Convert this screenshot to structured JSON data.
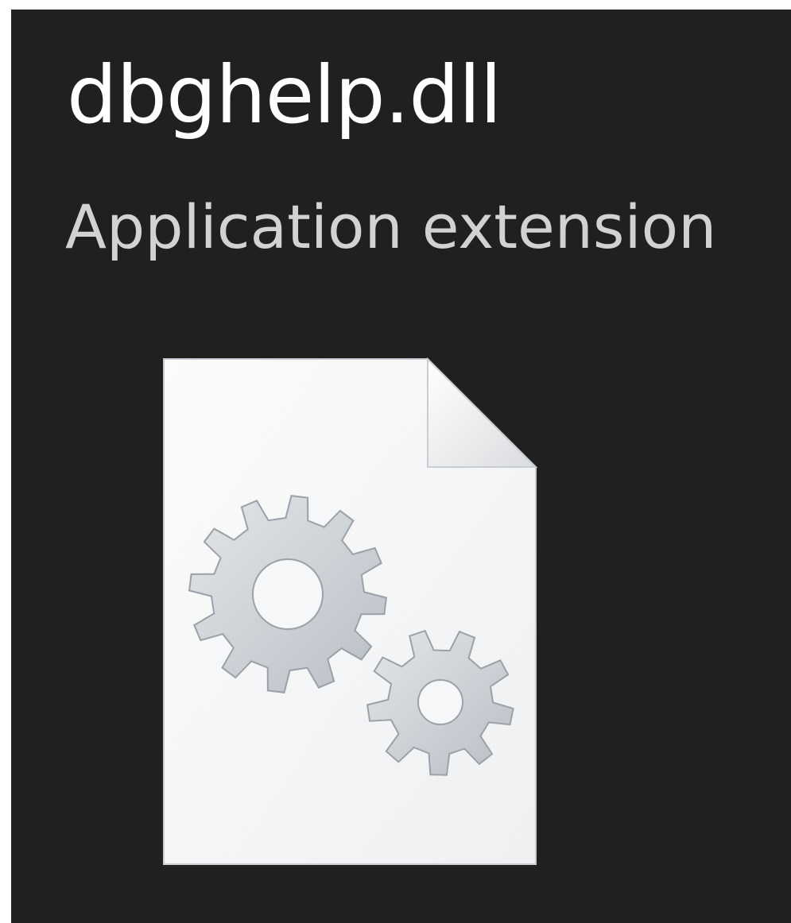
{
  "file": {
    "name": "dbghelp.dll",
    "type": "Application extension",
    "icon": "dll-gear-file-icon"
  },
  "colors": {
    "background": "#202020",
    "name_text": "#ffffff",
    "type_text": "#d2d2d2",
    "page": "#f4f5f6",
    "gear": "#c3c9ce"
  }
}
